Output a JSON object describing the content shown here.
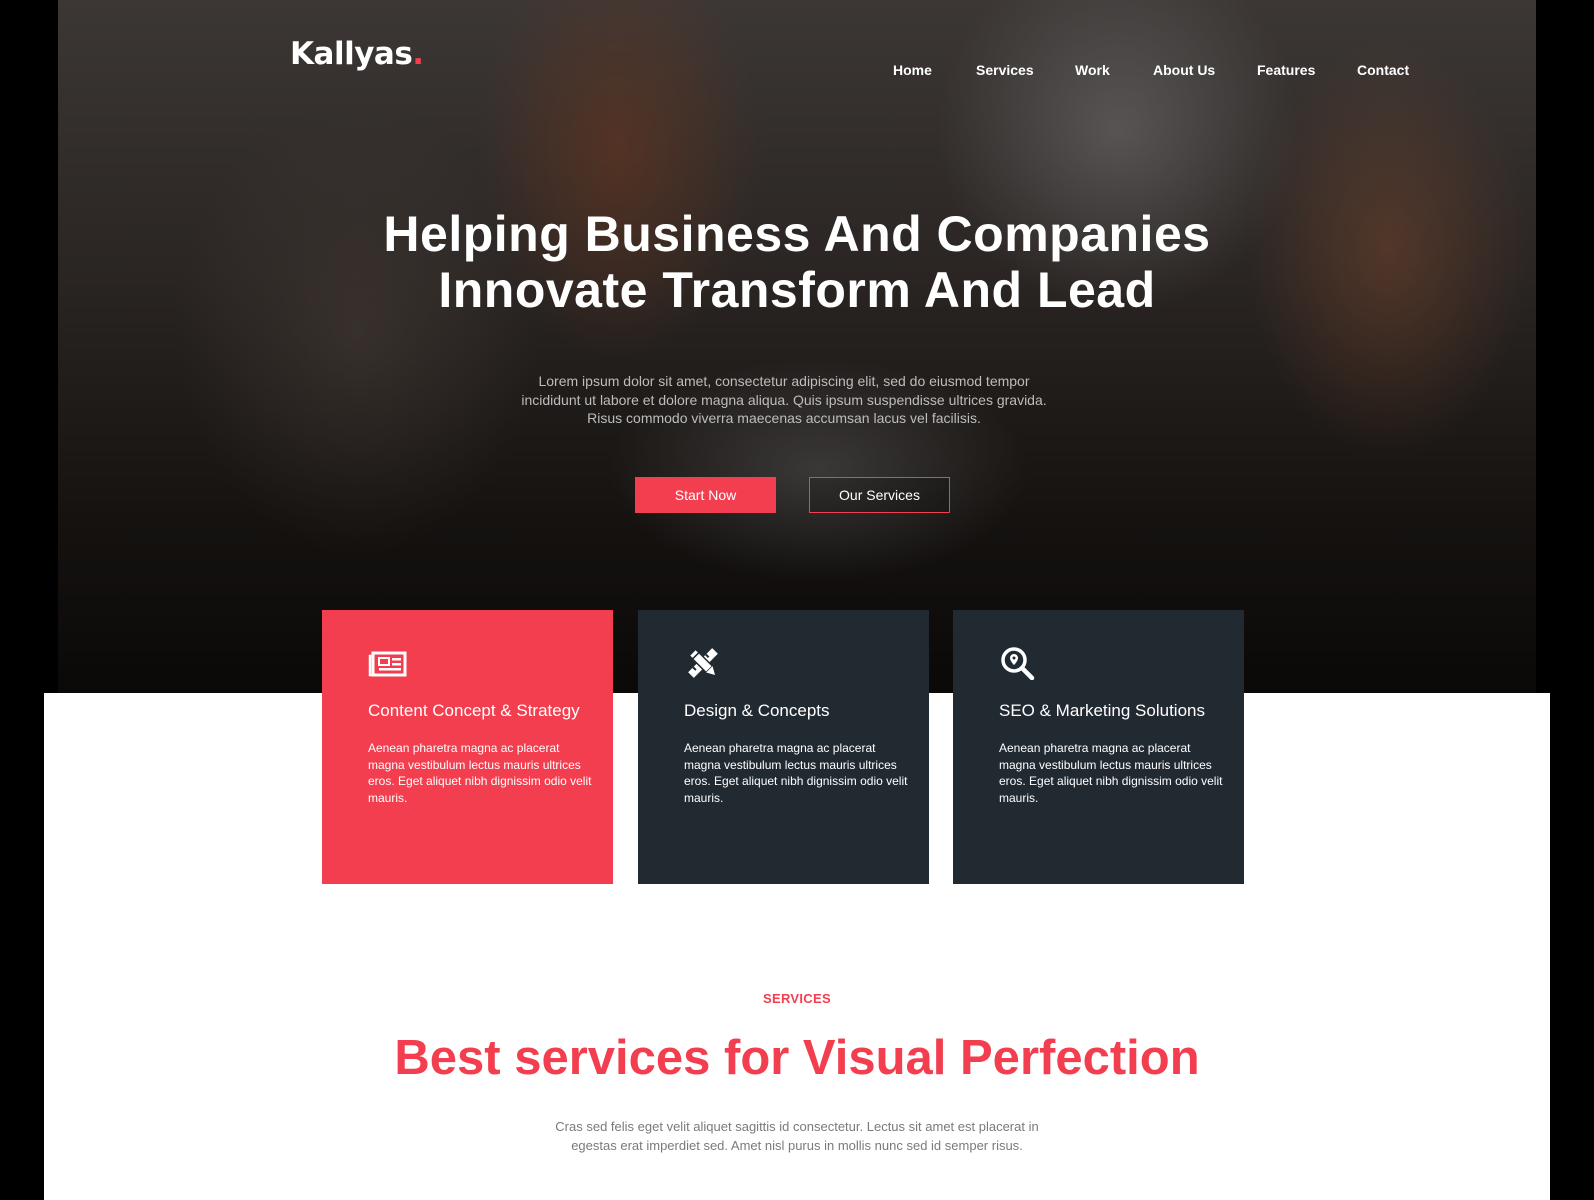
{
  "brand": {
    "name": "Kallyas",
    "dot": ".",
    "accent_color": "#f23e4e",
    "dark_color": "#222a31"
  },
  "nav": {
    "items": [
      {
        "label": "Home"
      },
      {
        "label": "Services"
      },
      {
        "label": "Work"
      },
      {
        "label": "About Us"
      },
      {
        "label": "Features"
      },
      {
        "label": "Contact"
      }
    ]
  },
  "hero": {
    "title_line1": "Helping Business And Companies",
    "title_line2": "Innovate Transform And Lead",
    "subtitle": "Lorem ipsum dolor sit amet, consectetur adipiscing elit, sed do eiusmod tempor incididunt ut labore et dolore magna aliqua. Quis ipsum suspendisse ultrices gravida. Risus commodo viverra maecenas accumsan lacus vel facilisis.",
    "primary_button": "Start Now",
    "secondary_button": "Our Services"
  },
  "features": [
    {
      "icon": "newspaper-icon",
      "title": "Content Concept & Strategy",
      "text": "Aenean pharetra magna ac placerat magna vestibulum lectus mauris ultrices eros. Eget aliquet nibh dignissim odio velit mauris."
    },
    {
      "icon": "pencil-ruler-icon",
      "title": "Design & Concepts",
      "text": "Aenean pharetra magna ac placerat magna vestibulum lectus mauris ultrices eros. Eget aliquet nibh dignissim odio velit mauris."
    },
    {
      "icon": "search-location-icon",
      "title": "SEO & Marketing Solutions",
      "text": "Aenean pharetra magna ac placerat magna vestibulum lectus mauris ultrices eros. Eget aliquet nibh dignissim odio velit mauris."
    }
  ],
  "services": {
    "label": "SERVICES",
    "title": "Best services for Visual Perfection",
    "text": "Cras sed felis eget velit aliquet sagittis id consectetur. Lectus sit amet est placerat in egestas erat imperdiet sed. Amet nisl purus in mollis nunc sed id semper risus."
  }
}
